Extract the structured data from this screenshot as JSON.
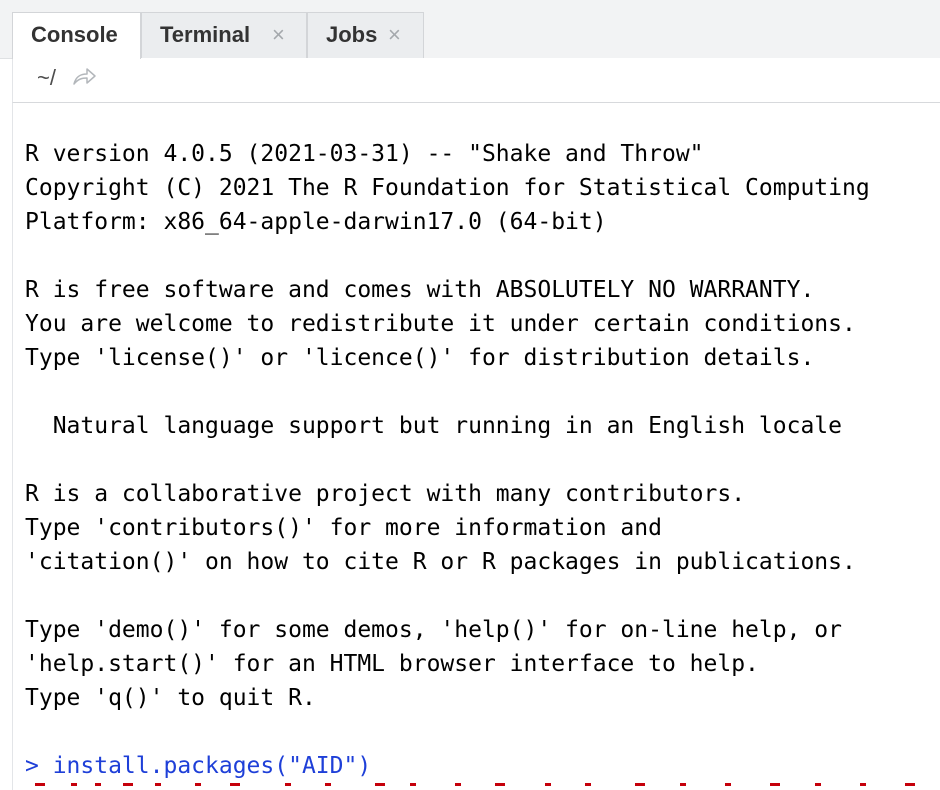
{
  "tabs": [
    {
      "label": "Console",
      "closable": false,
      "active": true
    },
    {
      "label": "Terminal",
      "closable": true,
      "close_glyph": "×",
      "active": false
    },
    {
      "label": "Jobs",
      "closable": true,
      "close_glyph": "×",
      "active": false
    }
  ],
  "toolbar": {
    "path": "~/",
    "go_icon": "go-to-directory-icon"
  },
  "console": {
    "output_lines": [
      "R version 4.0.5 (2021-03-31) -- \"Shake and Throw\"",
      "Copyright (C) 2021 The R Foundation for Statistical Computing",
      "Platform: x86_64-apple-darwin17.0 (64-bit)",
      "",
      "R is free software and comes with ABSOLUTELY NO WARRANTY.",
      "You are welcome to redistribute it under certain conditions.",
      "Type 'license()' or 'licence()' for distribution details.",
      "",
      "  Natural language support but running in an English locale",
      "",
      "R is a collaborative project with many contributors.",
      "Type 'contributors()' for more information and",
      "'citation()' on how to cite R or R packages in publications.",
      "",
      "Type 'demo()' for some demos, 'help()' for on-line help, or",
      "'help.start()' for an HTML browser interface to help.",
      "Type 'q()' to quit R."
    ],
    "command": "> install.packages(\"AID\")"
  },
  "colors": {
    "input_text": "#1e3fd8",
    "output_text": "#000000",
    "message_text": "#c5000b"
  }
}
